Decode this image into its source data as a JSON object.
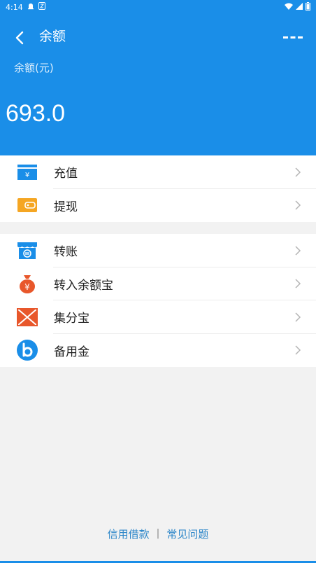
{
  "status_bar": {
    "time": "4:14",
    "icons": [
      "notification-icon",
      "app-icon",
      "wifi-icon",
      "signal-icon",
      "battery-icon"
    ]
  },
  "header": {
    "title": "余额",
    "balance_label": "余额(元)",
    "balance_value": "693.0"
  },
  "menu": {
    "group1": [
      {
        "label": "充值",
        "icon": "recharge-icon"
      },
      {
        "label": "提现",
        "icon": "withdraw-icon"
      }
    ],
    "group2": [
      {
        "label": "转账",
        "icon": "transfer-icon"
      },
      {
        "label": "转入余额宝",
        "icon": "money-bag-icon"
      },
      {
        "label": "集分宝",
        "icon": "points-icon"
      },
      {
        "label": "备用金",
        "icon": "reserve-fund-icon"
      }
    ]
  },
  "footer": {
    "link1": "信用借款",
    "separator": "|",
    "link2": "常见问题"
  },
  "colors": {
    "primary": "#1a8ee8",
    "link": "#2c86c9",
    "orange": "#f5a623",
    "red_orange": "#e8572b"
  }
}
